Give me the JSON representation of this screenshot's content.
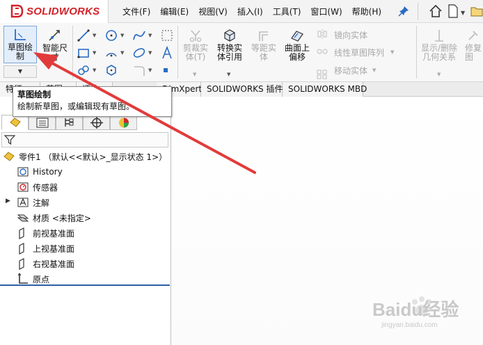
{
  "app": {
    "brand": "SOLIDWORKS",
    "menu": [
      "文件(F)",
      "编辑(E)",
      "视图(V)",
      "插入(I)",
      "工具(T)",
      "窗口(W)",
      "帮助(H)"
    ]
  },
  "toolbar": {
    "sketch_label_1": "草图绘",
    "sketch_label_2": "制",
    "smartdim_label_1": "智能尺",
    "smartdim_label_2": "寸",
    "trim_label_1": "剪裁实",
    "trim_label_2": "体(T)",
    "convert_label_1": "转换实",
    "convert_label_2": "体引用",
    "offset_label_1": "等距实",
    "offset_label_2": "体",
    "surface_offset_label_1": "曲面上",
    "surface_offset_label_2": "偏移",
    "mirror_label": "镜向实体",
    "linear_pattern_label": "线性草图阵列",
    "move_label": "移动实体",
    "show_relations_label_1": "显示/删除",
    "show_relations_label_2": "几何关系",
    "repair_label_1": "修复",
    "repair_label_2": "图"
  },
  "tabs": [
    "特征",
    "草图",
    "评估",
    "DimXpert",
    "SOLIDWORKS 插件",
    "SOLIDWORKS MBD"
  ],
  "tooltip": {
    "title": "草图绘制",
    "description": "绘制新草图，或编辑现有草图。"
  },
  "tree": {
    "part": "零件1 （默认<<默认>_显示状态 1>）",
    "history": "History",
    "sensors": "传感器",
    "annotations": "注解",
    "material": "材质 <未指定>",
    "front_plane": "前视基准面",
    "top_plane": "上视基准面",
    "right_plane": "右视基准面",
    "origin": "原点"
  },
  "watermark": {
    "text": "Baidu经验",
    "sub": "jingyan.baidu.com"
  },
  "colors": {
    "brand_red": "#d3222a",
    "annotation_arrow": "#e23b3b",
    "accent_blue": "#2b5fa6"
  }
}
